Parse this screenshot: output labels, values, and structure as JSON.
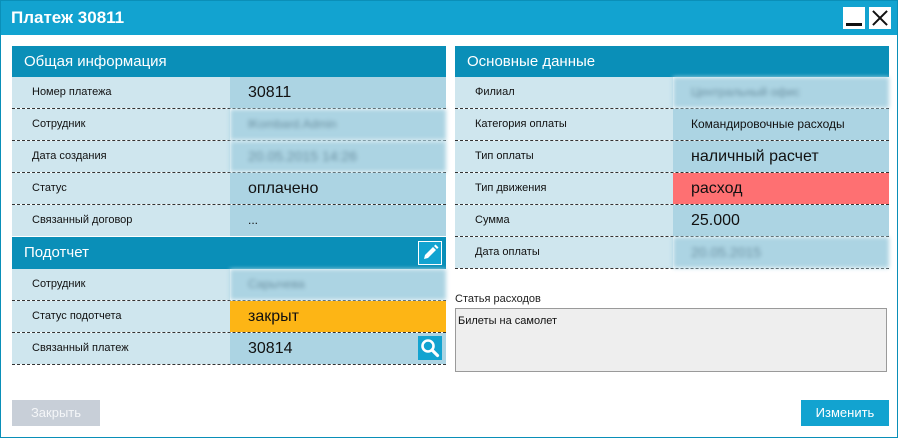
{
  "window": {
    "title": "Платеж 30811"
  },
  "general": {
    "header": "Общая информация",
    "rows": [
      {
        "label": "Номер платежа",
        "value": "30811"
      },
      {
        "label": "Сотрудник",
        "value": "lKombard.Admin"
      },
      {
        "label": "Дата создания",
        "value": "20.05.2015 14:26"
      },
      {
        "label": "Статус",
        "value": "оплачено"
      },
      {
        "label": "Связанный договор",
        "value": "..."
      }
    ]
  },
  "advance": {
    "header": "Подотчет",
    "rows": [
      {
        "label": "Сотрудник",
        "value": "Сарычева"
      },
      {
        "label": "Статус подотчета",
        "value": "закрыт"
      },
      {
        "label": "Связанный платеж",
        "value": "30814"
      }
    ]
  },
  "main_data": {
    "header": "Основные данные",
    "rows": [
      {
        "label": "Филиал",
        "value": "Центральный офис"
      },
      {
        "label": "Категория оплаты",
        "value": "Командировочные расходы"
      },
      {
        "label": "Тип оплаты",
        "value": "наличный расчет"
      },
      {
        "label": "Тип движения",
        "value": "расход"
      },
      {
        "label": "Сумма",
        "value": "25.000"
      },
      {
        "label": "Дата оплаты",
        "value": "20.05.2015"
      }
    ]
  },
  "expense_item": {
    "label": "Статья расходов",
    "value": "Билеты на самолет"
  },
  "buttons": {
    "close": "Закрыть",
    "edit": "Изменить"
  },
  "colors": {
    "titlebar": "#12a3d0",
    "panel_header": "#0a8fb8",
    "label_bg": "#cfe6ee",
    "value_bg": "#acd4e3",
    "status_closed": "#fdb515",
    "movement_expense": "#fe7072"
  }
}
